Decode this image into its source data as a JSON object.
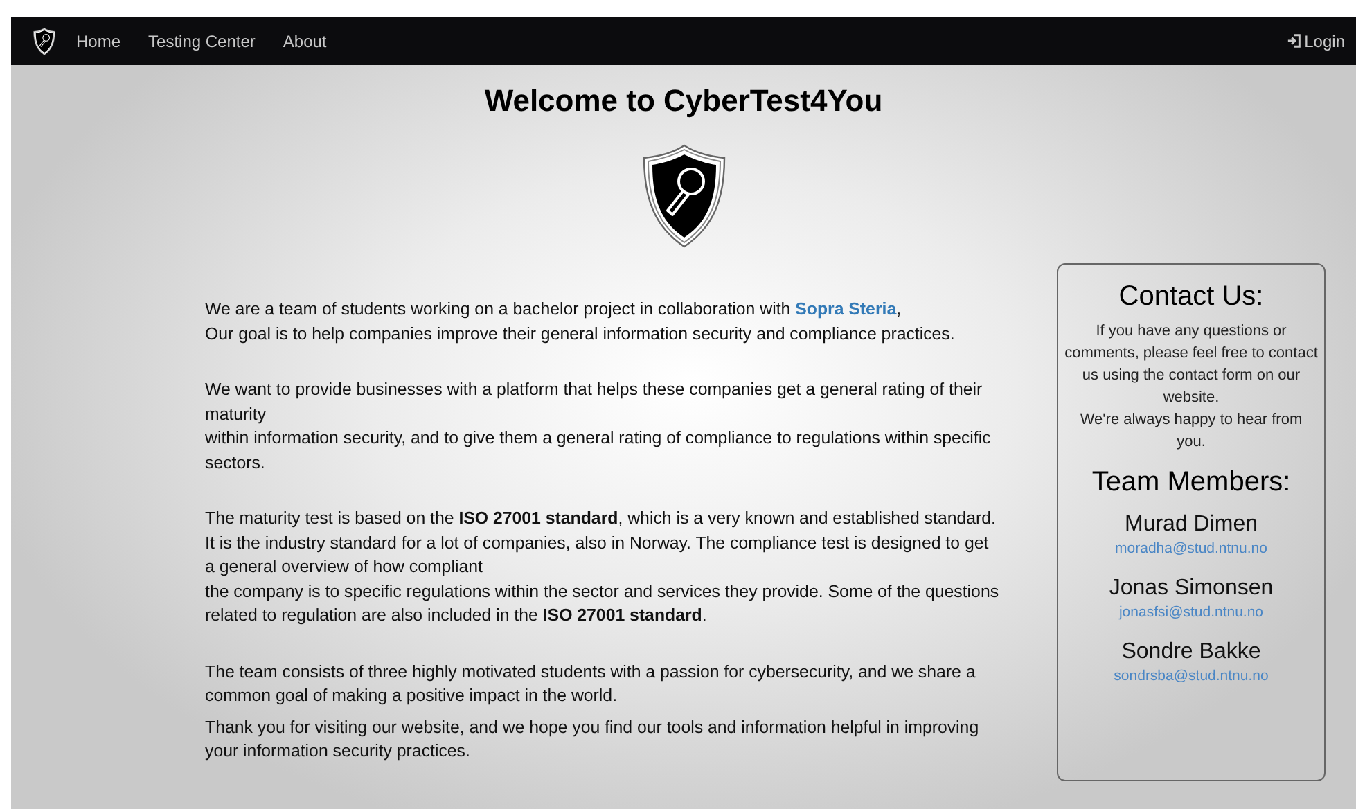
{
  "navbar": {
    "links": [
      {
        "label": "Home"
      },
      {
        "label": "Testing Center"
      },
      {
        "label": "About"
      }
    ],
    "login": "Login"
  },
  "title": "Welcome to CyberTest4You",
  "paragraphs": [
    {
      "lines": [
        [
          {
            "kind": "text",
            "text": "We are a team of students working on a bachelor project in collaboration with "
          },
          {
            "kind": "link",
            "text": "Sopra Steria"
          },
          {
            "kind": "text",
            "text": ","
          }
        ],
        [
          {
            "kind": "text",
            "text": "Our goal is to help companies improve their general information security and compliance practices."
          }
        ]
      ]
    },
    {
      "lines": [
        [
          {
            "kind": "text",
            "text": "We want to provide businesses with a platform that helps these companies get a general rating of their maturity"
          }
        ],
        [
          {
            "kind": "text",
            "text": "within information security, and to give them a general rating of compliance to regulations within specific sectors."
          }
        ]
      ]
    },
    {
      "lines": [
        [
          {
            "kind": "text",
            "text": "The maturity test is based on the **ISO 27001 standard**, which is a very known and established standard."
          }
        ],
        [
          {
            "kind": "text",
            "text": "It is the industry standard for a lot of companies, also in Norway. The compliance test is designed to get a general overview of how compliant"
          }
        ],
        [
          {
            "kind": "text",
            "text": "the company is to specific regulations within the sector and services they provide. Some of the questions related to regulation are also included in the **ISO 27001 standard**."
          }
        ]
      ]
    },
    {
      "lines": [
        [
          {
            "kind": "text",
            "text": "The team consists of three highly motivated students with a passion for cybersecurity, and we share a common goal of making a positive impact in the world."
          }
        ]
      ]
    },
    {
      "lines": [
        [
          {
            "kind": "text",
            "text": "Thank you for visiting our website, and we hope you find our tools and information helpful in improving your information security practices."
          }
        ]
      ]
    }
  ],
  "contact": {
    "title": "Contact Us:",
    "lines": [
      "If you have any questions or comments, please feel free to contact us using the contact form on our website.",
      "We're always happy to hear from you."
    ],
    "team_title": "Team Members:",
    "members": [
      {
        "name": "Murad Dimen",
        "email": "moradha@stud.ntnu.no"
      },
      {
        "name": "Jonas Simonsen",
        "email": "jonasfsi@stud.ntnu.no"
      },
      {
        "name": "Sondre Bakke",
        "email": "sondrsba@stud.ntnu.no"
      }
    ]
  }
}
